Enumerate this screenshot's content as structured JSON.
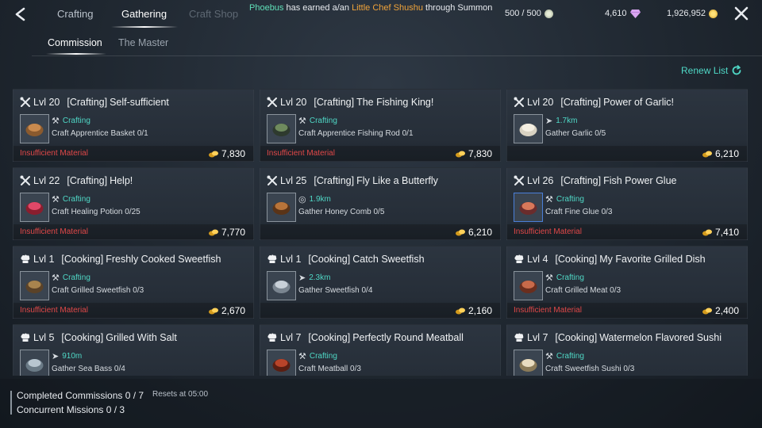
{
  "topbar": {
    "tabs": [
      {
        "label": "Crafting",
        "state": "inactive"
      },
      {
        "label": "Gathering",
        "state": "active"
      },
      {
        "label": "Craft Shop",
        "state": "disabled"
      }
    ],
    "announcement": {
      "player": "Phoebus",
      "middle": " has earned a/an ",
      "item": "Little Chef Shushu",
      "suffix": " through Summon"
    },
    "energy": "500 / 500",
    "gems": "4,610",
    "gold": "1,926,952"
  },
  "subtabs": [
    {
      "label": "Commission",
      "state": "active"
    },
    {
      "label": "The Master",
      "state": "inactive"
    }
  ],
  "renew_label": "Renew List",
  "commissions": [
    {
      "level": "Lvl 20",
      "category": "[Crafting]",
      "title": "Self-sufficient",
      "kind": "crafting",
      "subtype": "Crafting",
      "detail": "Craft Apprentice Basket 0/1",
      "warning": "Insufficient Material",
      "reward": "7,830",
      "item_icon": "basket-icon",
      "rare": false
    },
    {
      "level": "Lvl 20",
      "category": "[Crafting]",
      "title": "The Fishing King!",
      "kind": "crafting",
      "subtype": "Crafting",
      "detail": "Craft Apprentice Fishing Rod 0/1",
      "warning": "Insufficient Material",
      "reward": "7,830",
      "item_icon": "fishing-rod-icon",
      "rare": false
    },
    {
      "level": "Lvl 20",
      "category": "[Crafting]",
      "title": "Power of Garlic!",
      "kind": "crafting",
      "subtype": "1.7km",
      "subtype_icon": "arrow",
      "detail": "Gather Garlic 0/5",
      "warning": "",
      "reward": "6,210",
      "item_icon": "garlic-icon",
      "rare": false
    },
    {
      "level": "Lvl 22",
      "category": "[Crafting]",
      "title": "Help!",
      "kind": "crafting",
      "subtype": "Crafting",
      "detail": "Craft Healing Potion 0/25",
      "warning": "Insufficient Material",
      "reward": "7,770",
      "item_icon": "potion-icon",
      "rare": false
    },
    {
      "level": "Lvl 25",
      "category": "[Crafting]",
      "title": "Fly Like a Butterfly",
      "kind": "crafting",
      "subtype": "1.9km",
      "subtype_icon": "compass",
      "detail": "Gather Honey Comb 0/5",
      "warning": "",
      "reward": "6,210",
      "item_icon": "honeycomb-icon",
      "rare": false
    },
    {
      "level": "Lvl 26",
      "category": "[Crafting]",
      "title": "Fish Power Glue",
      "kind": "crafting",
      "subtype": "Crafting",
      "detail": "Craft Fine Glue 0/3",
      "warning": "Insufficient Material",
      "reward": "7,410",
      "item_icon": "glue-bowl-icon",
      "rare": true
    },
    {
      "level": "Lvl 1",
      "category": "[Cooking]",
      "title": "Freshly Cooked Sweetfish",
      "kind": "cooking",
      "subtype": "Crafting",
      "detail": "Craft Grilled Sweetfish 0/3",
      "warning": "Insufficient Material",
      "reward": "2,670",
      "item_icon": "grilled-fish-icon",
      "rare": false
    },
    {
      "level": "Lvl 1",
      "category": "[Cooking]",
      "title": "Catch Sweetfish",
      "kind": "cooking",
      "subtype": "2.3km",
      "subtype_icon": "arrow",
      "detail": "Gather Sweetfish 0/4",
      "warning": "",
      "reward": "2,160",
      "item_icon": "fish-icon",
      "rare": false
    },
    {
      "level": "Lvl 4",
      "category": "[Cooking]",
      "title": "My Favorite Grilled Dish",
      "kind": "cooking",
      "subtype": "Crafting",
      "detail": "Craft Grilled Meat 0/3",
      "warning": "Insufficient Material",
      "reward": "2,400",
      "item_icon": "grilled-meat-icon",
      "rare": false
    },
    {
      "level": "Lvl 5",
      "category": "[Cooking]",
      "title": "Grilled With Salt",
      "kind": "cooking",
      "subtype": "910m",
      "subtype_icon": "arrow",
      "detail": "Gather Sea Bass 0/4",
      "warning": "",
      "reward": "",
      "item_icon": "sea-bass-icon",
      "rare": false
    },
    {
      "level": "Lvl 7",
      "category": "[Cooking]",
      "title": "Perfectly Round Meatball",
      "kind": "cooking",
      "subtype": "Crafting",
      "detail": "Craft Meatball 0/3",
      "warning": "",
      "reward": "",
      "item_icon": "meatball-icon",
      "rare": false
    },
    {
      "level": "Lvl 7",
      "category": "[Cooking]",
      "title": "Watermelon Flavored Sushi",
      "kind": "cooking",
      "subtype": "Crafting",
      "detail": "Craft Sweetfish Sushi 0/3",
      "warning": "",
      "reward": "",
      "item_icon": "sushi-icon",
      "rare": false
    }
  ],
  "bottom": {
    "completed": "Completed Commissions 0 / 7",
    "reset": "Resets at 05:00",
    "concurrent": "Concurrent Missions 0 / 3"
  }
}
